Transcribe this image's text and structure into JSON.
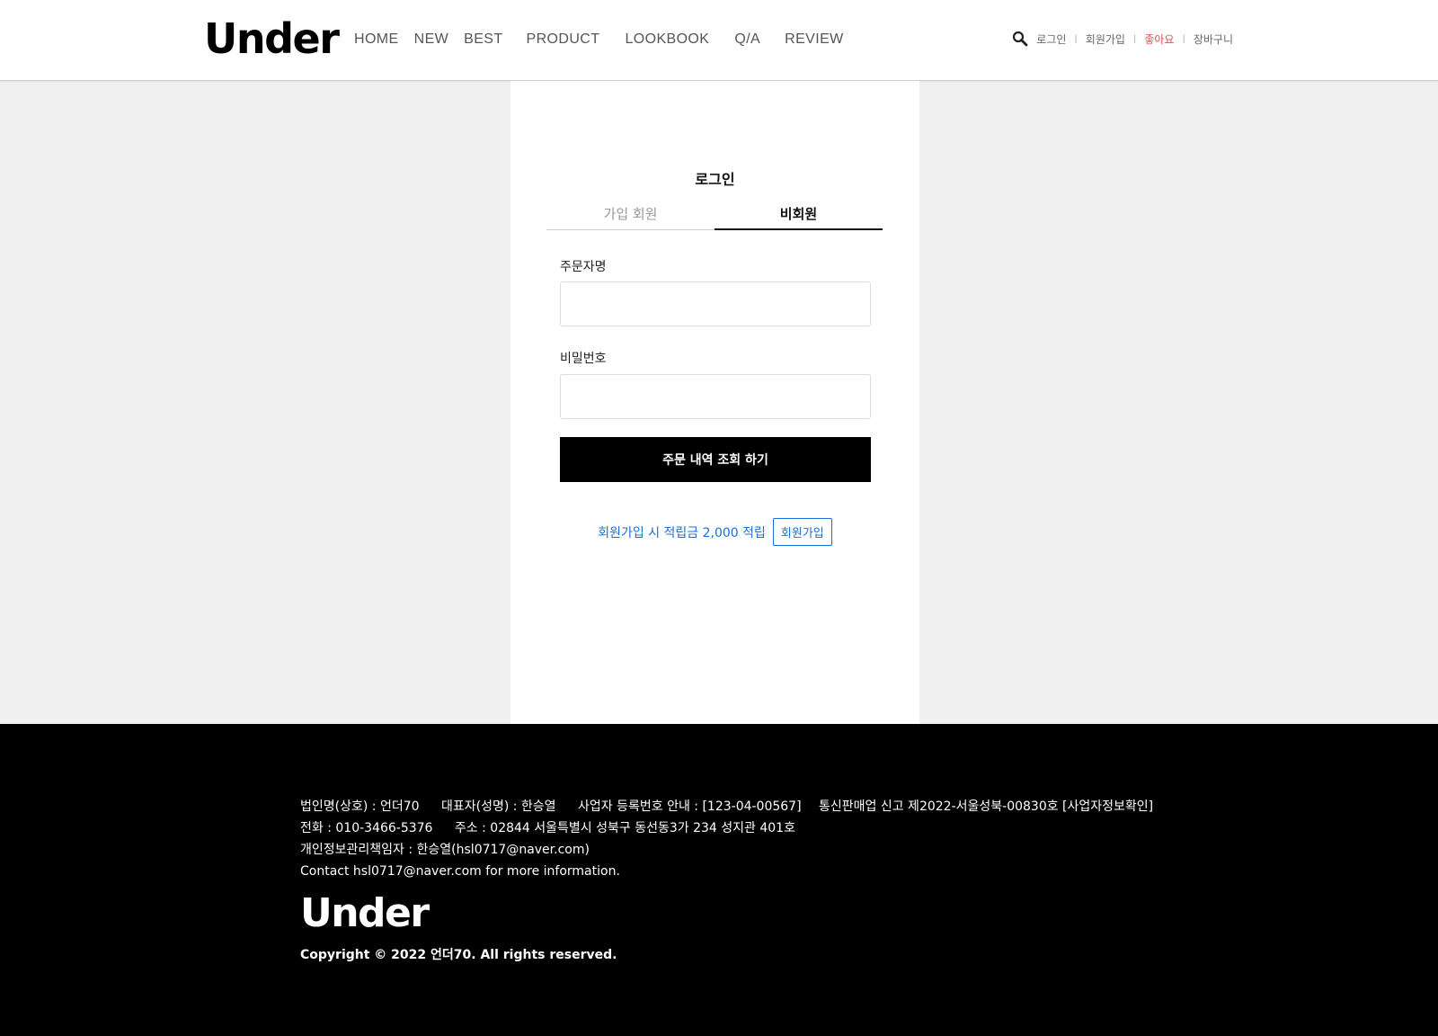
{
  "header": {
    "logo": "Under",
    "nav": [
      "HOME",
      "NEW",
      "BEST",
      "PRODUCT",
      "LOOKBOOK",
      "Q/A",
      "REVIEW"
    ],
    "util": {
      "login": "로그인",
      "signup": "회원가입",
      "like": "좋아요",
      "cart": "장바구니",
      "separator": "|"
    },
    "colors": {
      "like": "#e05050"
    }
  },
  "login": {
    "title": "로그인",
    "tabs": [
      "가입 회원",
      "비회원"
    ],
    "active_tab": "비회원",
    "order_name_label": "주문자명",
    "order_name_value": "",
    "password_label": "비밀번호",
    "password_value": "",
    "submit_label": "주문 내역 조회 하기",
    "promo_text": "회원가입 시 적립금 2,000 적립",
    "promo_button": "회원가입",
    "colors": {
      "promo": "#1a6fd6",
      "button": "#000000"
    }
  },
  "footer": {
    "line1": [
      "법인명(상호) : 언더70",
      "대표자(성명) : 한승열",
      "사업자 등록번호 안내 : [123-04-00567]"
    ],
    "line2": [
      "전화 : 010-3466-5376",
      "주소 : 02844 서울특별시 성북구 동선동3가 234 성지관 401호"
    ],
    "line3": "개인정보관리책임자 : 한승열(hsl0717@naver.com)",
    "line4": "Contact hsl0717@naver.com for more information.",
    "right": "통신판매업 신고 제2022-서울성북-00830호 [사업자정보확인]",
    "logo": "Under",
    "copyright": "Copyright © 2022 언더70. All rights reserved."
  }
}
